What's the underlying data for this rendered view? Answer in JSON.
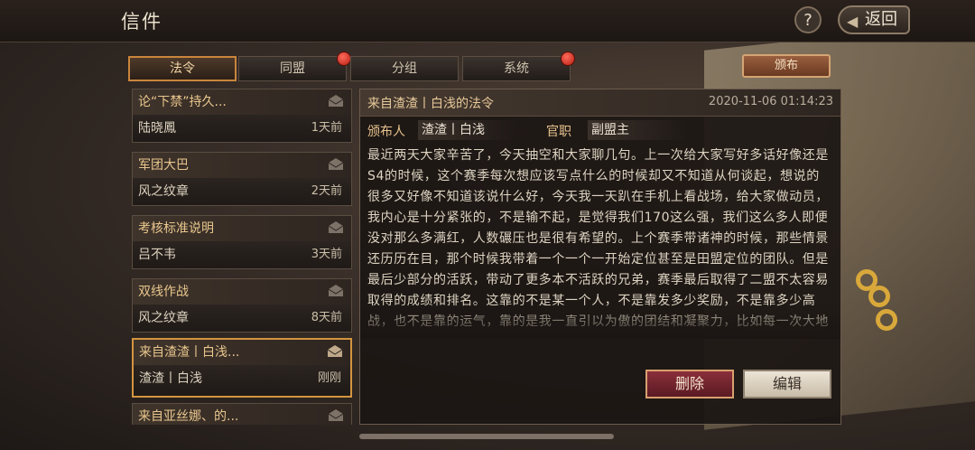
{
  "header": {
    "title": "信件",
    "help_label": "?",
    "back_label": "返回"
  },
  "tabs": [
    {
      "label": "法令",
      "active": true,
      "has_dot": false
    },
    {
      "label": "同盟",
      "active": false,
      "has_dot": true
    },
    {
      "label": "分组",
      "active": false,
      "has_dot": false
    },
    {
      "label": "系统",
      "active": false,
      "has_dot": true
    }
  ],
  "publish_label": "颁布",
  "mails": [
    {
      "title": "论“下禁”持久...",
      "sender": "陆晓鳳",
      "time": "1天前"
    },
    {
      "title": "军团大巴",
      "sender": "风之纹章",
      "time": "2天前"
    },
    {
      "title": "考核标准说明",
      "sender": "吕不韦",
      "time": "3天前"
    },
    {
      "title": "双线作战",
      "sender": "风之纹章",
      "time": "8天前"
    },
    {
      "title": "来自渣渣丨白浅...",
      "sender": "渣渣丨白浅",
      "time": "刚刚",
      "selected": true
    },
    {
      "title": "来自亚丝娜、的...",
      "sender": "",
      "time": ""
    }
  ],
  "detail": {
    "title": "来自渣渣丨白浅的法令",
    "date": "2020-11-06 01:14:23",
    "publisher_label": "颁布人",
    "publisher": "渣渣丨白浅",
    "rank_label": "官职",
    "rank": "副盟主",
    "content": "最近两天大家辛苦了，今天抽空和大家聊几句。上一次给大家写好多话好像还是S4的时候，这个赛季每次想应该写点什么的时候却又不知道从何谈起，想说的很多又好像不知道该说什么好，今天我一天趴在手机上看战场，给大家做动员，我内心是十分紧张的，不是输不起，是觉得我们170这么强，我们这么多人即便没对那么多满红，人数碾压也是很有希望的。上个赛季带诸神的时候，那些情景还历历在目，那个时候我带着一个一个一开始定位甚至是田盟定位的团队。但是最后少部分的活跃，带动了更多本不活跃的兄弟，赛季最后取得了二盟不太容易取得的成绩和排名。这靠的不是某一个人，不是靠发多少奖励，不是靠多少高战，也不是靠的运气，靠的是我一直引以为傲的团结和凝聚力，比如每一次大地",
    "delete_label": "删除",
    "edit_label": "编辑"
  }
}
